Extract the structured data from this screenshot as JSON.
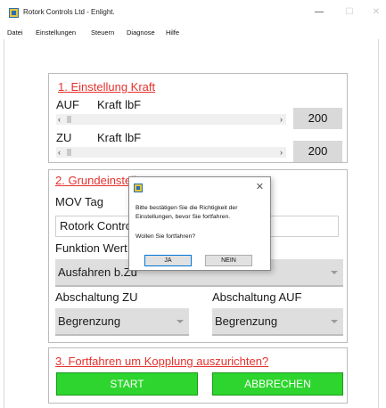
{
  "window": {
    "title": "Rotork Controls Ltd - Enlight.",
    "minimize_glyph": "—",
    "maximize_glyph": "☐",
    "close_glyph": "✕"
  },
  "menu": [
    "Datei",
    "Einstellungen",
    "Steuern",
    "Diagnose",
    "Hilfe"
  ],
  "section1": {
    "title": "1. Einstellung Kraft",
    "rows": [
      {
        "direction": "AUF",
        "label": "Kraft lbF",
        "value": "200"
      },
      {
        "direction": "ZU",
        "label": "Kraft lbF",
        "value": "200"
      }
    ]
  },
  "section2": {
    "title": "2. Grundeinstellungen",
    "mov_tag_label": "MOV Tag",
    "mov_tag_value": "Rotork Controls",
    "funktion_label": "Funktion Wert",
    "funktion_value": "Ausfahren b.Zu",
    "abschaltung_zu_label": "Abschaltung ZU",
    "abschaltung_zu_value": "Begrenzung",
    "abschaltung_auf_label": "Abschaltung AUF",
    "abschaltung_auf_value": "Begrenzung"
  },
  "section3": {
    "title": "3. Fortfahren um Kopplung auszurichten?",
    "start_label": "START",
    "abbrechen_label": "ABBRECHEN"
  },
  "dialog": {
    "line1": "Bitte bestätigen Sie die Richtigkeit der",
    "line2": "Einstellungen, bevor Sie fortfahren.",
    "question": "Wollen Sie fortfahren?",
    "yes_label": "JA",
    "no_label": "NEIN",
    "close_glyph": "✕"
  },
  "colors": {
    "section_title": "#e5322d",
    "button_green": "#2ed52e",
    "dialog_default_border": "#0078d7"
  }
}
